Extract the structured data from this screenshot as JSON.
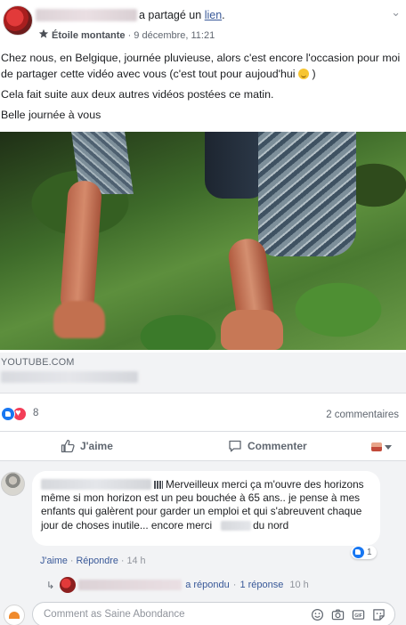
{
  "post": {
    "shared_suffix": "a partagé un",
    "shared_link_label": "lien",
    "badge": "Étoile montante",
    "meta_sep": " · ",
    "date": "9 décembre, 11:21",
    "menu_glyph": "⌄",
    "text_paragraph_1": "Chez nous, en Belgique, journée pluvieuse, alors c'est encore l'occasion pour moi de partager cette vidéo avec vous (c'est tout pour aujoud'hui",
    "text_paragraph_1_end": " )",
    "text_paragraph_2": "Cela fait suite aux deux autres vidéos postées ce matin.",
    "text_paragraph_3": "Belle journée à vous"
  },
  "link_preview": {
    "domain": "YOUTUBE.COM"
  },
  "reactions": {
    "count": "8",
    "comments_count": "2 commentaires"
  },
  "actions": {
    "like_label": "J'aime",
    "comment_label": "Commenter"
  },
  "comment": {
    "text_line": "Merveilleux merci ça m'ouvre des horizons même si mon horizon est un peu bouchée à 65 ans.. je pense à mes enfants qui galèrent pour garder un emploi et qui s'abreuvent chaque jour de choses inutile... encore merci",
    "text_tail": "du nord",
    "reaction_count": "1",
    "like_action": "J'aime",
    "reply_action": "Répondre",
    "sep": "·",
    "time": "14 h"
  },
  "reply_summary": {
    "replied": "a répondu",
    "sep": "·",
    "reply_count": "1 réponse",
    "time": "10 h"
  },
  "composer": {
    "placeholder": "Comment as Saine Abondance"
  },
  "icons": {
    "star": "star-icon",
    "thumb": "thumbs-up-icon",
    "comment": "comment-bubble-icon",
    "emoji": "emoji-icon",
    "camera": "camera-icon",
    "gif": "gif-icon",
    "sticker": "sticker-icon"
  },
  "colors": {
    "link": "#385898",
    "like_blue": "#1877f2",
    "love_red": "#f33e58",
    "muted": "#606770"
  }
}
